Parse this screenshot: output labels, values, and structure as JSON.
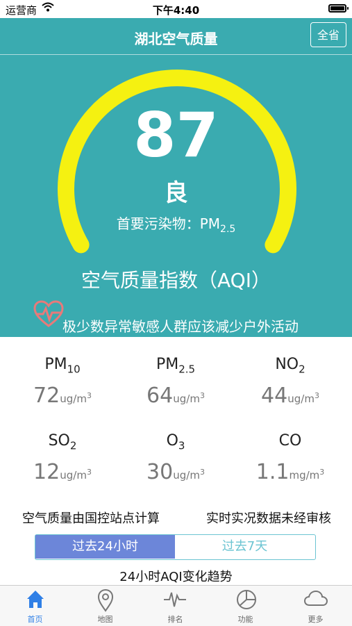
{
  "status_bar": {
    "carrier": "运营商",
    "time": "下午4:40"
  },
  "nav": {
    "title": "湖北空气质量",
    "province_button": "全省"
  },
  "aqi": {
    "value": "87",
    "level": "良",
    "primary_label": "首要污染物：",
    "primary_main": "PM",
    "primary_sub": "2.5",
    "index_label": "空气质量指数（AQI）",
    "advice": "极少数异常敏感人群应该减少户外活动",
    "gauge_color": "#f5f111"
  },
  "pollutants": [
    {
      "name": "PM",
      "sub": "10",
      "value": "72",
      "unit": "ug/m",
      "unit_sup": "3"
    },
    {
      "name": "PM",
      "sub": "2.5",
      "value": "64",
      "unit": "ug/m",
      "unit_sup": "3"
    },
    {
      "name": "NO",
      "sub": "2",
      "value": "44",
      "unit": "ug/m",
      "unit_sup": "3"
    },
    {
      "name": "SO",
      "sub": "2",
      "value": "12",
      "unit": "ug/m",
      "unit_sup": "3"
    },
    {
      "name": "O",
      "sub": "3",
      "value": "30",
      "unit": "ug/m",
      "unit_sup": "3"
    },
    {
      "name": "CO",
      "sub": "",
      "value": "1.1",
      "unit": "mg/m",
      "unit_sup": "3"
    }
  ],
  "notes": {
    "left": "空气质量由国控站点计算",
    "right": "实时实况数据未经审核"
  },
  "segment": {
    "tab1": "过去24小时",
    "tab2": "过去7天",
    "selected": "过去24小时"
  },
  "trend_title": "24小时AQI变化趋势",
  "tabs": [
    {
      "label": "首页",
      "icon": "home-icon"
    },
    {
      "label": "地图",
      "icon": "map-pin-icon"
    },
    {
      "label": "排名",
      "icon": "pulse-icon"
    },
    {
      "label": "功能",
      "icon": "pie-chart-icon"
    },
    {
      "label": "更多",
      "icon": "cloud-icon"
    }
  ],
  "colors": {
    "header_bg": "#3aabb0",
    "accent": "#2f7fe6",
    "segment_active": "#6c86d9",
    "segment_border": "#6bc4d2"
  }
}
